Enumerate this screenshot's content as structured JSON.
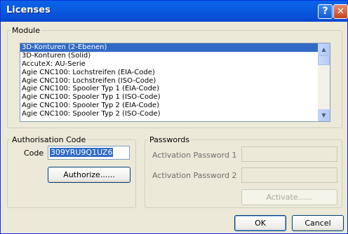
{
  "window": {
    "title": "Licenses"
  },
  "title_buttons": {
    "help": "?",
    "close": "✕"
  },
  "module": {
    "legend": "Module",
    "items": [
      "3D-Konturen (2-Ebenen)",
      "3D-Konturen (Solid)",
      "AccuteX: AU-Serie",
      "Agie CNC100: Lochstreifen  (EIA-Code)",
      "Agie CNC100: Lochstreifen  (ISO-Code)",
      "Agie CNC100: Spooler Typ 1 (EIA-Code)",
      "Agie CNC100: Spooler Typ 1 (ISO-Code)",
      "Agie CNC100: Spooler Typ 2 (EIA-Code)",
      "Agie CNC100: Spooler Typ 2 (ISO-Code)"
    ],
    "selected_index": 0
  },
  "authorisation": {
    "legend": "Authorisation Code",
    "code_label": "Code",
    "code_value": "309YRU9Q1UZ6",
    "authorize_label": "Authorize......"
  },
  "passwords": {
    "legend": "Passwords",
    "activation1_label": "Activation Password 1",
    "activation2_label": "Activation Password 2",
    "activate_label": "Activate......"
  },
  "footer": {
    "ok_label": "OK",
    "cancel_label": "Cancel"
  },
  "colors": {
    "selection": "#316AC5",
    "titlebar": "#0A5AE0",
    "face": "#ECE9D8"
  }
}
